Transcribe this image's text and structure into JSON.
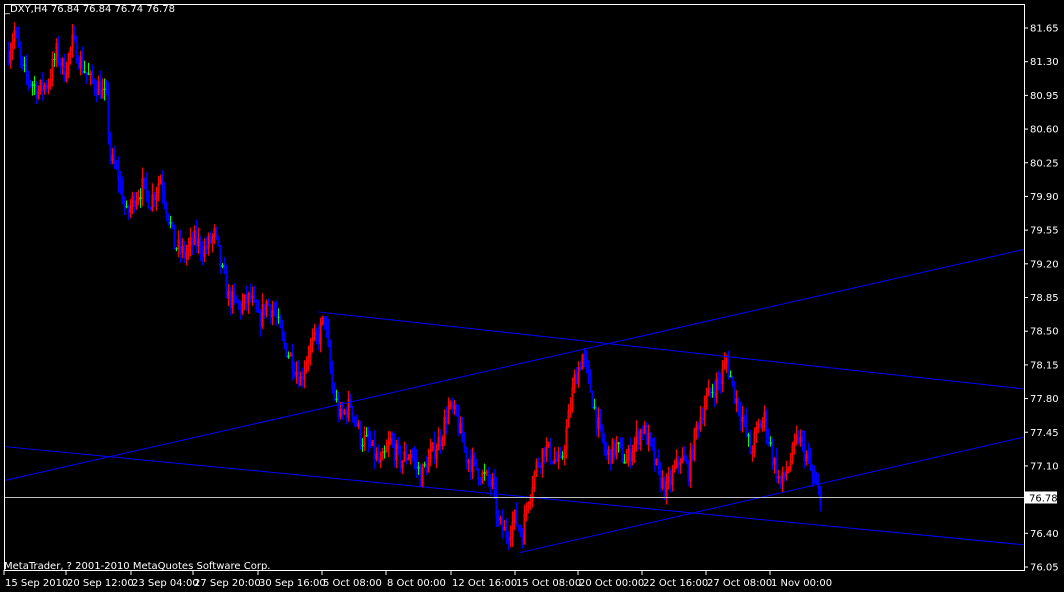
{
  "window": {
    "title": "_DXY,H4  76.84 76.84 76.74 76.78",
    "copyright": "MetaTrader, ? 2001-2010 MetaQuotes Software Corp."
  },
  "colors": {
    "background": "#000000",
    "frame": "#ffffff",
    "bull_candle": "#ff0000",
    "bear_candle": "#0000ff",
    "doji_candle": "#00ff00",
    "trendline": "#0000ff",
    "price_line": "#c0c0c0",
    "text": "#ffffff"
  },
  "chart_data": {
    "type": "candlestick",
    "symbol": "_DXY",
    "timeframe": "H4",
    "ohlc_header": {
      "open": 76.84,
      "high": 76.84,
      "low": 76.74,
      "close": 76.78
    },
    "current_price": "76.78",
    "y_ticks": [
      "81.65",
      "81.30",
      "80.95",
      "80.60",
      "80.25",
      "79.90",
      "79.55",
      "79.20",
      "78.85",
      "78.50",
      "78.15",
      "77.80",
      "77.45",
      "77.10",
      "76.40",
      "76.05"
    ],
    "ylim": [
      76.05,
      81.65
    ],
    "x_ticks": [
      "15 Sep 2010",
      "20 Sep 12:00",
      "23 Sep 04:00",
      "27 Sep 20:00",
      "30 Sep 16:00",
      "5 Oct 08:00",
      "8 Oct 00:00",
      "12 Oct 16:00",
      "15 Oct 08:00",
      "20 Oct 00:00",
      "22 Oct 16:00",
      "27 Oct 08:00",
      "1 Nov 00:00"
    ],
    "series_path": [
      [
        0,
        81.4
      ],
      [
        6,
        81.62
      ],
      [
        14,
        81.2
      ],
      [
        30,
        81.0
      ],
      [
        40,
        81.1
      ],
      [
        48,
        81.4
      ],
      [
        56,
        81.2
      ],
      [
        64,
        81.5
      ],
      [
        72,
        81.3
      ],
      [
        82,
        81.1
      ],
      [
        90,
        81.05
      ],
      [
        98,
        80.9
      ],
      [
        102,
        80.3
      ],
      [
        110,
        80.1
      ],
      [
        118,
        79.7
      ],
      [
        126,
        79.9
      ],
      [
        134,
        80.0
      ],
      [
        142,
        79.85
      ],
      [
        152,
        80.1
      ],
      [
        160,
        79.7
      ],
      [
        166,
        79.4
      ],
      [
        176,
        79.3
      ],
      [
        186,
        79.45
      ],
      [
        196,
        79.35
      ],
      [
        206,
        79.5
      ],
      [
        214,
        79.1
      ],
      [
        220,
        78.85
      ],
      [
        232,
        78.75
      ],
      [
        242,
        78.85
      ],
      [
        250,
        78.6
      ],
      [
        258,
        78.8
      ],
      [
        266,
        78.7
      ],
      [
        274,
        78.4
      ],
      [
        284,
        78.2
      ],
      [
        292,
        78.0
      ],
      [
        300,
        78.3
      ],
      [
        310,
        78.45
      ],
      [
        316,
        78.65
      ],
      [
        324,
        77.9
      ],
      [
        332,
        77.6
      ],
      [
        342,
        77.75
      ],
      [
        352,
        77.4
      ],
      [
        362,
        77.3
      ],
      [
        372,
        77.1
      ],
      [
        382,
        77.35
      ],
      [
        392,
        77.15
      ],
      [
        402,
        77.25
      ],
      [
        412,
        77.0
      ],
      [
        422,
        77.2
      ],
      [
        432,
        77.4
      ],
      [
        440,
        77.7
      ],
      [
        448,
        77.6
      ],
      [
        458,
        77.2
      ],
      [
        466,
        77.1
      ],
      [
        474,
        77.0
      ],
      [
        484,
        76.9
      ],
      [
        490,
        76.5
      ],
      [
        498,
        76.4
      ],
      [
        506,
        76.55
      ],
      [
        514,
        76.4
      ],
      [
        520,
        76.8
      ],
      [
        528,
        77.1
      ],
      [
        536,
        77.3
      ],
      [
        544,
        77.2
      ],
      [
        552,
        77.1
      ],
      [
        560,
        77.6
      ],
      [
        566,
        78.0
      ],
      [
        574,
        78.25
      ],
      [
        582,
        77.9
      ],
      [
        590,
        77.5
      ],
      [
        598,
        77.2
      ],
      [
        608,
        77.3
      ],
      [
        618,
        77.15
      ],
      [
        626,
        77.35
      ],
      [
        634,
        77.5
      ],
      [
        642,
        77.3
      ],
      [
        650,
        77.0
      ],
      [
        658,
        76.85
      ],
      [
        664,
        77.0
      ],
      [
        672,
        77.2
      ],
      [
        680,
        77.05
      ],
      [
        688,
        77.5
      ],
      [
        696,
        77.75
      ],
      [
        704,
        77.9
      ],
      [
        712,
        78.0
      ],
      [
        718,
        78.2
      ],
      [
        726,
        77.85
      ],
      [
        734,
        77.6
      ],
      [
        742,
        77.25
      ],
      [
        750,
        77.5
      ],
      [
        756,
        77.6
      ],
      [
        764,
        77.2
      ],
      [
        772,
        76.9
      ],
      [
        780,
        77.1
      ],
      [
        790,
        77.4
      ],
      [
        798,
        77.2
      ],
      [
        806,
        76.9
      ],
      [
        812,
        76.8
      ]
    ],
    "trendlines": [
      {
        "from": [
          318,
          78.7
        ],
        "to": [
          1024,
          77.9
        ]
      },
      {
        "from": [
          5,
          76.95
        ],
        "to": [
          1024,
          79.35
        ]
      },
      {
        "from": [
          5,
          77.3
        ],
        "to": [
          1024,
          76.28
        ]
      },
      {
        "from": [
          520,
          76.2
        ],
        "to": [
          1024,
          77.4
        ]
      }
    ]
  }
}
